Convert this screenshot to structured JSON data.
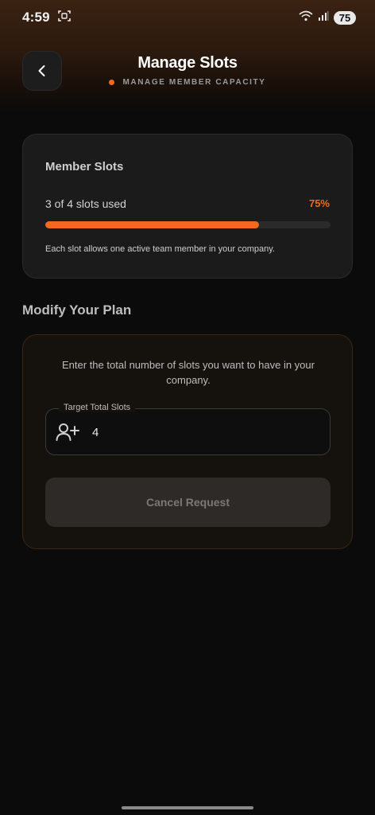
{
  "status_bar": {
    "time": "4:59",
    "battery": "75"
  },
  "header": {
    "title": "Manage Slots",
    "subtitle": "MANAGE MEMBER CAPACITY"
  },
  "member_slots": {
    "title": "Member Slots",
    "usage_text": "3 of 4 slots used",
    "usage_percent_label": "75%",
    "usage_fraction": 0.75,
    "note": "Each slot allows one active team member in your company."
  },
  "modify_plan": {
    "section_title": "Modify Your Plan",
    "description": "Enter the total number of slots you want to have in your company.",
    "target_label": "Target Total Slots",
    "target_value": "4",
    "cancel_label": "Cancel Request"
  },
  "colors": {
    "accent": "#f26a1b",
    "background": "#0b0b0b",
    "card": "#1b1b1b"
  }
}
